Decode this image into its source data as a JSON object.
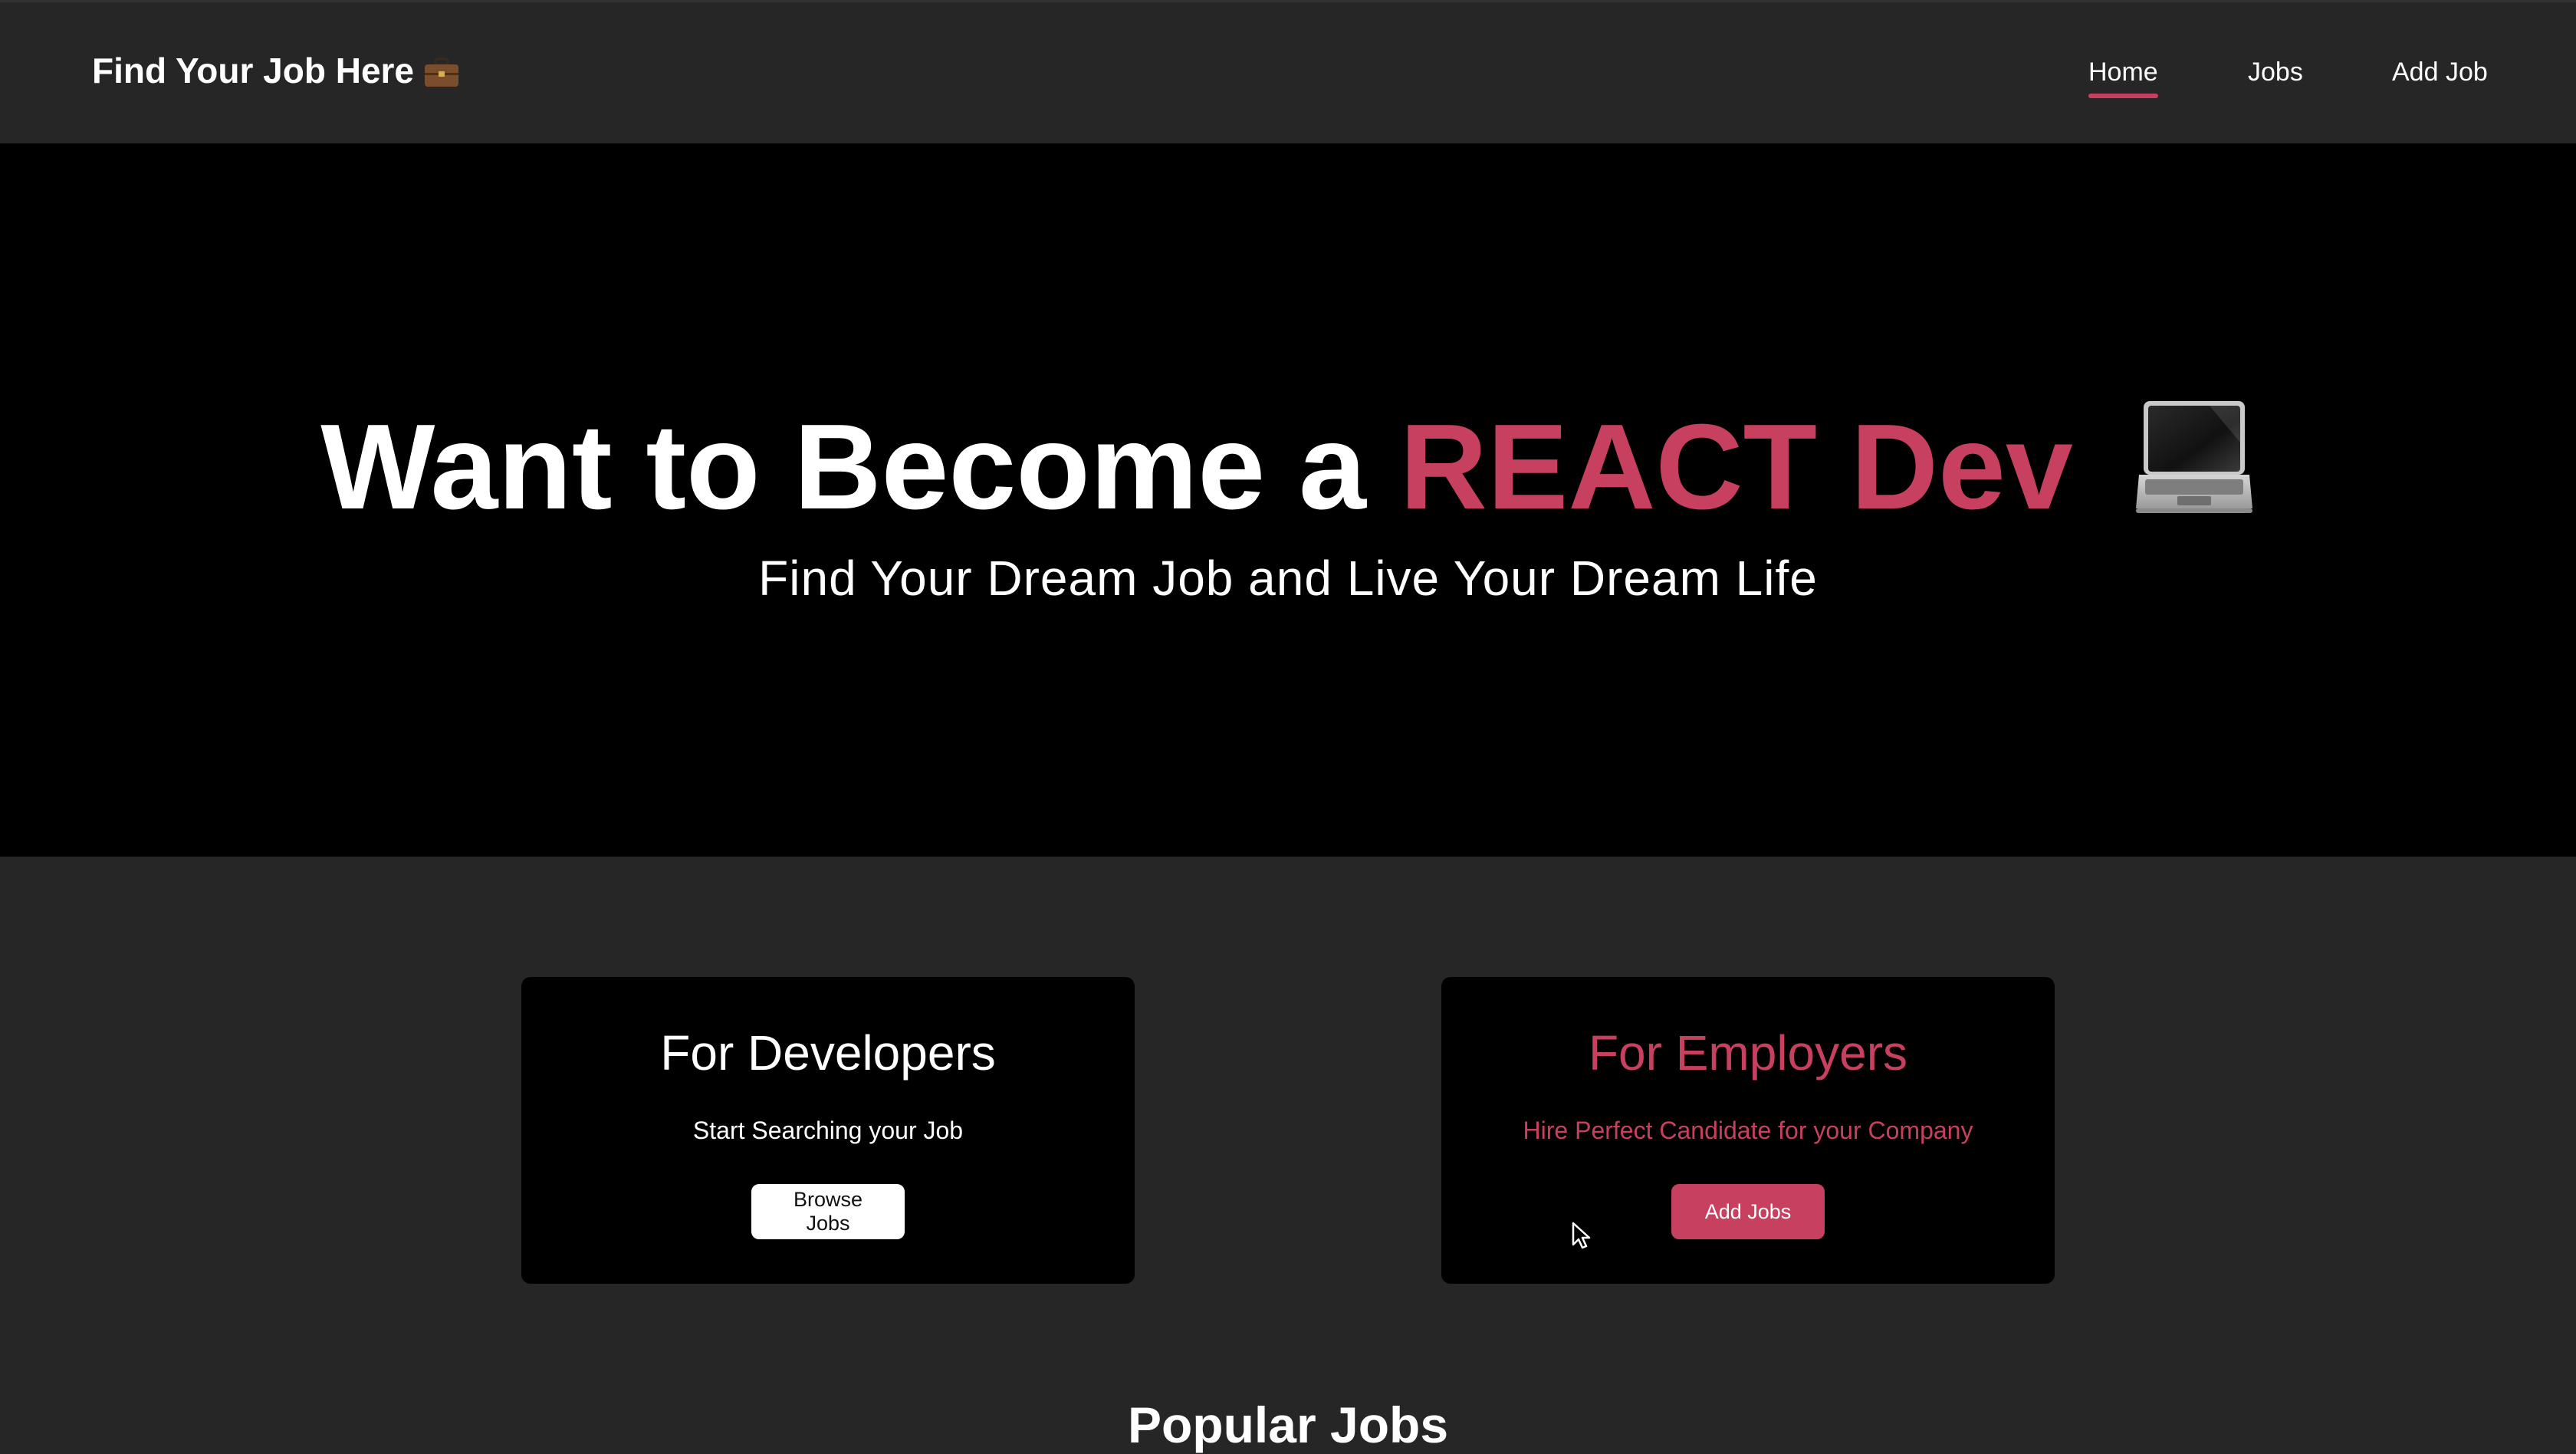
{
  "navbar": {
    "brand": "Find Your Job Here",
    "brand_icon": "briefcase-icon",
    "links": [
      {
        "label": "Home",
        "active": true
      },
      {
        "label": "Jobs",
        "active": false
      },
      {
        "label": "Add Job",
        "active": false
      }
    ]
  },
  "hero": {
    "title_prefix": "Want to Become a",
    "title_accent": "REACT Dev",
    "title_icon": "laptop-icon",
    "subtitle": "Find Your Dream Job and Live Your Dream Life"
  },
  "cards": {
    "developers": {
      "title": "For Developers",
      "text": "Start Searching your Job",
      "button": "Browse Jobs"
    },
    "employers": {
      "title": "For Employers",
      "text": "Hire Perfect Candidate for your Company",
      "button": "Add Jobs"
    }
  },
  "popular": {
    "title": "Popular Jobs"
  },
  "colors": {
    "accent": "#c8405f",
    "background": "#262626",
    "hero_background": "#000000"
  }
}
